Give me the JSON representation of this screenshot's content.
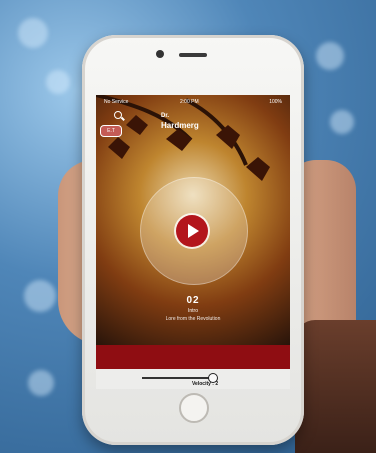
{
  "screen": {
    "status": {
      "left": "No Service",
      "center": "2:00 PM",
      "right": "100%"
    },
    "header": {
      "kicker": "Dr.",
      "title": "Hardmerg",
      "lang_badge": "E.T"
    },
    "player": {
      "track_number": "02",
      "track_name": "Intro",
      "track_subtitle": "Lore from the Revolution"
    },
    "controls": {
      "speed_label": "Velocity : 2",
      "speed_level": 0.85
    }
  },
  "colors": {
    "play_button": "#b3151c",
    "red_bar": "#8f0d12",
    "background": "#4f86b8"
  },
  "icons": [
    "search-icon",
    "play-icon",
    "home-button"
  ]
}
